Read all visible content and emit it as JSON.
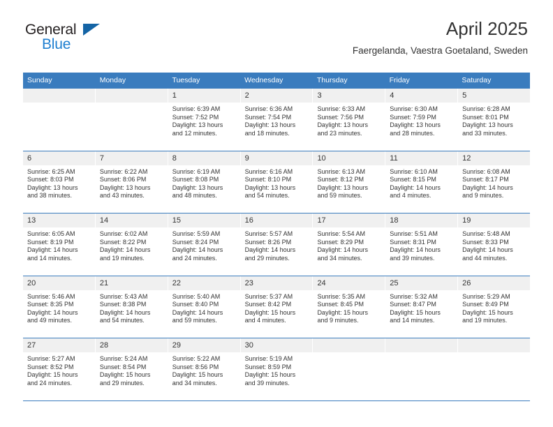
{
  "brand": {
    "line1": "General",
    "line2": "Blue",
    "mark": "triangle-logo"
  },
  "header": {
    "title": "April 2025",
    "location": "Faergelanda, Vaestra Goetaland, Sweden"
  },
  "colors": {
    "header_blue": "#3a7cbe",
    "brand_blue": "#1f7fd0",
    "day_band": "#f0f0f0",
    "text": "#333333"
  },
  "weekdays": [
    "Sunday",
    "Monday",
    "Tuesday",
    "Wednesday",
    "Thursday",
    "Friday",
    "Saturday"
  ],
  "labels": {
    "sunrise": "Sunrise:",
    "sunset": "Sunset:",
    "daylight": "Daylight:"
  },
  "weeks": [
    [
      {
        "day": "",
        "sunrise": "",
        "sunset": "",
        "daylight1": "",
        "daylight2": ""
      },
      {
        "day": "",
        "sunrise": "",
        "sunset": "",
        "daylight1": "",
        "daylight2": ""
      },
      {
        "day": "1",
        "sunrise": "Sunrise: 6:39 AM",
        "sunset": "Sunset: 7:52 PM",
        "daylight1": "Daylight: 13 hours",
        "daylight2": "and 12 minutes."
      },
      {
        "day": "2",
        "sunrise": "Sunrise: 6:36 AM",
        "sunset": "Sunset: 7:54 PM",
        "daylight1": "Daylight: 13 hours",
        "daylight2": "and 18 minutes."
      },
      {
        "day": "3",
        "sunrise": "Sunrise: 6:33 AM",
        "sunset": "Sunset: 7:56 PM",
        "daylight1": "Daylight: 13 hours",
        "daylight2": "and 23 minutes."
      },
      {
        "day": "4",
        "sunrise": "Sunrise: 6:30 AM",
        "sunset": "Sunset: 7:59 PM",
        "daylight1": "Daylight: 13 hours",
        "daylight2": "and 28 minutes."
      },
      {
        "day": "5",
        "sunrise": "Sunrise: 6:28 AM",
        "sunset": "Sunset: 8:01 PM",
        "daylight1": "Daylight: 13 hours",
        "daylight2": "and 33 minutes."
      }
    ],
    [
      {
        "day": "6",
        "sunrise": "Sunrise: 6:25 AM",
        "sunset": "Sunset: 8:03 PM",
        "daylight1": "Daylight: 13 hours",
        "daylight2": "and 38 minutes."
      },
      {
        "day": "7",
        "sunrise": "Sunrise: 6:22 AM",
        "sunset": "Sunset: 8:06 PM",
        "daylight1": "Daylight: 13 hours",
        "daylight2": "and 43 minutes."
      },
      {
        "day": "8",
        "sunrise": "Sunrise: 6:19 AM",
        "sunset": "Sunset: 8:08 PM",
        "daylight1": "Daylight: 13 hours",
        "daylight2": "and 48 minutes."
      },
      {
        "day": "9",
        "sunrise": "Sunrise: 6:16 AM",
        "sunset": "Sunset: 8:10 PM",
        "daylight1": "Daylight: 13 hours",
        "daylight2": "and 54 minutes."
      },
      {
        "day": "10",
        "sunrise": "Sunrise: 6:13 AM",
        "sunset": "Sunset: 8:12 PM",
        "daylight1": "Daylight: 13 hours",
        "daylight2": "and 59 minutes."
      },
      {
        "day": "11",
        "sunrise": "Sunrise: 6:10 AM",
        "sunset": "Sunset: 8:15 PM",
        "daylight1": "Daylight: 14 hours",
        "daylight2": "and 4 minutes."
      },
      {
        "day": "12",
        "sunrise": "Sunrise: 6:08 AM",
        "sunset": "Sunset: 8:17 PM",
        "daylight1": "Daylight: 14 hours",
        "daylight2": "and 9 minutes."
      }
    ],
    [
      {
        "day": "13",
        "sunrise": "Sunrise: 6:05 AM",
        "sunset": "Sunset: 8:19 PM",
        "daylight1": "Daylight: 14 hours",
        "daylight2": "and 14 minutes."
      },
      {
        "day": "14",
        "sunrise": "Sunrise: 6:02 AM",
        "sunset": "Sunset: 8:22 PM",
        "daylight1": "Daylight: 14 hours",
        "daylight2": "and 19 minutes."
      },
      {
        "day": "15",
        "sunrise": "Sunrise: 5:59 AM",
        "sunset": "Sunset: 8:24 PM",
        "daylight1": "Daylight: 14 hours",
        "daylight2": "and 24 minutes."
      },
      {
        "day": "16",
        "sunrise": "Sunrise: 5:57 AM",
        "sunset": "Sunset: 8:26 PM",
        "daylight1": "Daylight: 14 hours",
        "daylight2": "and 29 minutes."
      },
      {
        "day": "17",
        "sunrise": "Sunrise: 5:54 AM",
        "sunset": "Sunset: 8:29 PM",
        "daylight1": "Daylight: 14 hours",
        "daylight2": "and 34 minutes."
      },
      {
        "day": "18",
        "sunrise": "Sunrise: 5:51 AM",
        "sunset": "Sunset: 8:31 PM",
        "daylight1": "Daylight: 14 hours",
        "daylight2": "and 39 minutes."
      },
      {
        "day": "19",
        "sunrise": "Sunrise: 5:48 AM",
        "sunset": "Sunset: 8:33 PM",
        "daylight1": "Daylight: 14 hours",
        "daylight2": "and 44 minutes."
      }
    ],
    [
      {
        "day": "20",
        "sunrise": "Sunrise: 5:46 AM",
        "sunset": "Sunset: 8:35 PM",
        "daylight1": "Daylight: 14 hours",
        "daylight2": "and 49 minutes."
      },
      {
        "day": "21",
        "sunrise": "Sunrise: 5:43 AM",
        "sunset": "Sunset: 8:38 PM",
        "daylight1": "Daylight: 14 hours",
        "daylight2": "and 54 minutes."
      },
      {
        "day": "22",
        "sunrise": "Sunrise: 5:40 AM",
        "sunset": "Sunset: 8:40 PM",
        "daylight1": "Daylight: 14 hours",
        "daylight2": "and 59 minutes."
      },
      {
        "day": "23",
        "sunrise": "Sunrise: 5:37 AM",
        "sunset": "Sunset: 8:42 PM",
        "daylight1": "Daylight: 15 hours",
        "daylight2": "and 4 minutes."
      },
      {
        "day": "24",
        "sunrise": "Sunrise: 5:35 AM",
        "sunset": "Sunset: 8:45 PM",
        "daylight1": "Daylight: 15 hours",
        "daylight2": "and 9 minutes."
      },
      {
        "day": "25",
        "sunrise": "Sunrise: 5:32 AM",
        "sunset": "Sunset: 8:47 PM",
        "daylight1": "Daylight: 15 hours",
        "daylight2": "and 14 minutes."
      },
      {
        "day": "26",
        "sunrise": "Sunrise: 5:29 AM",
        "sunset": "Sunset: 8:49 PM",
        "daylight1": "Daylight: 15 hours",
        "daylight2": "and 19 minutes."
      }
    ],
    [
      {
        "day": "27",
        "sunrise": "Sunrise: 5:27 AM",
        "sunset": "Sunset: 8:52 PM",
        "daylight1": "Daylight: 15 hours",
        "daylight2": "and 24 minutes."
      },
      {
        "day": "28",
        "sunrise": "Sunrise: 5:24 AM",
        "sunset": "Sunset: 8:54 PM",
        "daylight1": "Daylight: 15 hours",
        "daylight2": "and 29 minutes."
      },
      {
        "day": "29",
        "sunrise": "Sunrise: 5:22 AM",
        "sunset": "Sunset: 8:56 PM",
        "daylight1": "Daylight: 15 hours",
        "daylight2": "and 34 minutes."
      },
      {
        "day": "30",
        "sunrise": "Sunrise: 5:19 AM",
        "sunset": "Sunset: 8:59 PM",
        "daylight1": "Daylight: 15 hours",
        "daylight2": "and 39 minutes."
      },
      {
        "day": "",
        "sunrise": "",
        "sunset": "",
        "daylight1": "",
        "daylight2": ""
      },
      {
        "day": "",
        "sunrise": "",
        "sunset": "",
        "daylight1": "",
        "daylight2": ""
      },
      {
        "day": "",
        "sunrise": "",
        "sunset": "",
        "daylight1": "",
        "daylight2": ""
      }
    ]
  ]
}
